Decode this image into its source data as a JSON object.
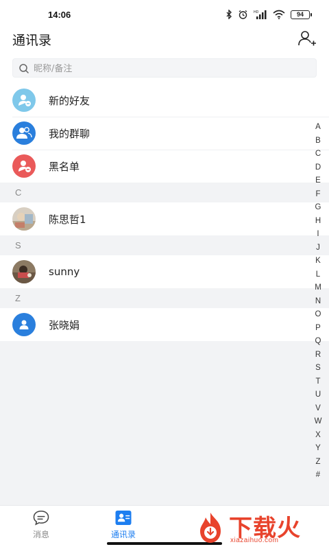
{
  "status_bar": {
    "time": "14:06",
    "battery": "94"
  },
  "header": {
    "title": "通讯录"
  },
  "search": {
    "placeholder": "昵称/备注"
  },
  "functions": [
    {
      "label": "新的好友",
      "icon": "new-friend-icon",
      "color": "#7fc8ea"
    },
    {
      "label": "我的群聊",
      "icon": "group-chat-icon",
      "color": "#2a7fdd"
    },
    {
      "label": "黑名单",
      "icon": "blacklist-icon",
      "color": "#ea5a5a"
    }
  ],
  "sections": [
    {
      "letter": "C",
      "contacts": [
        {
          "name": "陈思哲1",
          "avatar": "photo-avatar"
        }
      ]
    },
    {
      "letter": "S",
      "contacts": [
        {
          "name": "sunny",
          "avatar": "photo-avatar"
        }
      ]
    },
    {
      "letter": "Z",
      "contacts": [
        {
          "name": "张晓娟",
          "avatar": "default-avatar",
          "color": "#2a7fdd"
        }
      ]
    }
  ],
  "index": [
    "A",
    "B",
    "C",
    "D",
    "E",
    "F",
    "G",
    "H",
    "I",
    "J",
    "K",
    "L",
    "M",
    "N",
    "O",
    "P",
    "Q",
    "R",
    "S",
    "T",
    "U",
    "V",
    "W",
    "X",
    "Y",
    "Z",
    "#"
  ],
  "tabs": [
    {
      "label": "消息",
      "icon": "message-icon",
      "active": false
    },
    {
      "label": "通讯录",
      "icon": "contacts-icon",
      "active": true
    }
  ],
  "watermark": {
    "text": "下载火",
    "url": "xiazaihuo.com"
  },
  "colors": {
    "accent": "#1d7ef0",
    "blacklist": "#ea5a5a",
    "watermark": "#e8432c"
  }
}
